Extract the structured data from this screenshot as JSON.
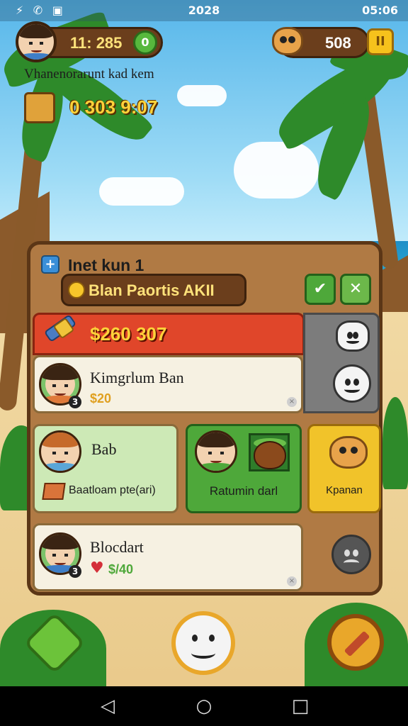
{
  "status_bar": {
    "left_icons": "⚡ ✆ ▣",
    "clock": "2028",
    "time": "05:06"
  },
  "hud": {
    "coins_value": "11: 285",
    "coin_button_label": "0",
    "currency_value": "508",
    "pause_label": "II",
    "quest_title": "Vhanenorarunt kad kem",
    "score_value": "0 303 9:07"
  },
  "panel": {
    "header_label": "Inet kun 1",
    "plus_label": "+",
    "subtitle": "Blan Paortis AKII",
    "accept_label": "✔",
    "close_label": "✕",
    "reward_amount": "$260 307",
    "card1": {
      "name": "Kimgrlum Ban",
      "level": "3",
      "sub": "$20"
    },
    "card2": {
      "name": "Bab",
      "item": "Baatloam pte(ari)"
    },
    "green_card_label": "Ratumin darl",
    "yellow_card_label": "Kpanan",
    "card3": {
      "name": "Blocdart",
      "level": "3",
      "sub": "$/40"
    }
  },
  "nav": {
    "back": "◁",
    "home": "○",
    "recent": "□"
  }
}
